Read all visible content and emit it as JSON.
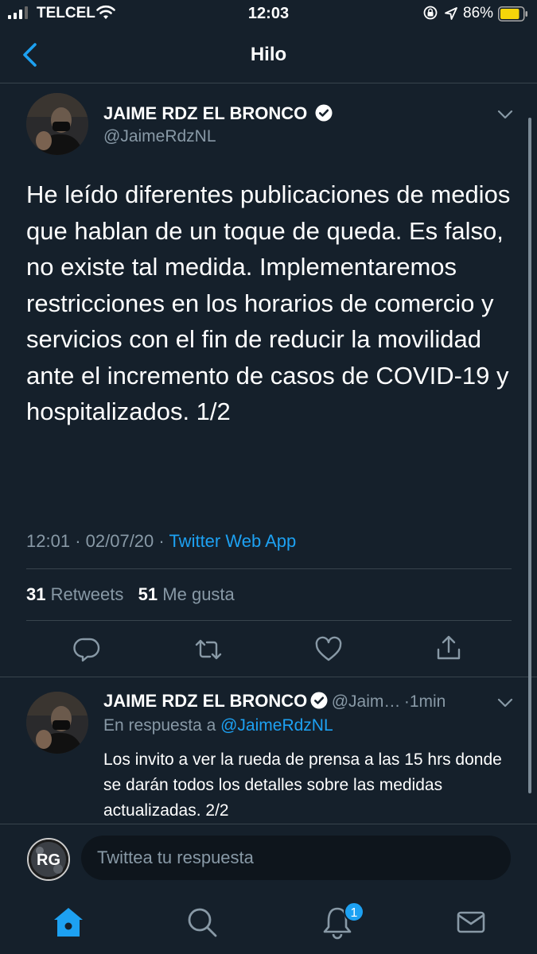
{
  "status_bar": {
    "carrier": "TELCEL",
    "time": "12:03",
    "battery_percent": "86%"
  },
  "nav": {
    "title": "Hilo"
  },
  "main_tweet": {
    "author_name": "JAIME RDZ EL BRONCO",
    "author_handle": "@JaimeRdzNL",
    "verified": true,
    "text": "He leído diferentes publicaciones de medios que hablan de un toque de queda. Es falso, no existe tal medida. Implementaremos restricciones en los horarios de comercio y servicios con el fin de reducir la movilidad ante el incremento de casos de COVID-19 y hospitalizados. 1/2",
    "time": "12:01",
    "separator1": "·",
    "date": "02/07/20",
    "separator2": "·",
    "source": "Twitter Web App",
    "retweets_count": "31",
    "retweets_label": "Retweets",
    "likes_count": "51",
    "likes_label": "Me gusta"
  },
  "reply_tweet": {
    "author_name": "JAIME RDZ EL BRONCO",
    "author_handle": "@Jaim…",
    "separator": "·",
    "age": "1min",
    "in_reply_label": "En respuesta a",
    "in_reply_mention": "@JaimeRdzNL",
    "text": "Los invito a ver la rueda de prensa a las 15 hrs donde se darán todos los detalles sobre las medidas actualizadas. 2/2"
  },
  "compose": {
    "avatar_text": "RG",
    "placeholder": "Twittea tu respuesta"
  },
  "tab_bar": {
    "notifications_badge": "1"
  },
  "colors": {
    "background": "#15202b",
    "accent": "#1da1f2",
    "secondary_text": "#8899a6",
    "divider": "#38444d"
  }
}
